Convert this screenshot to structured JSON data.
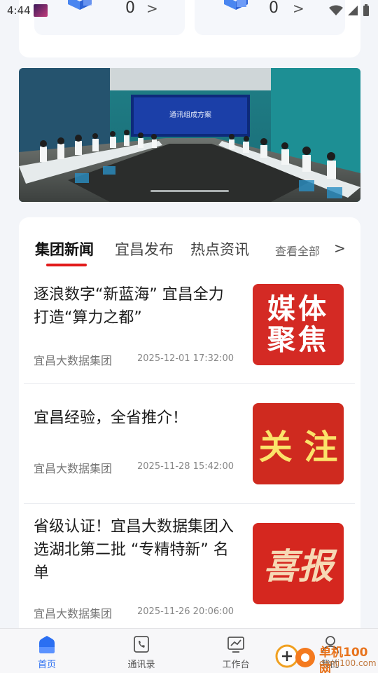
{
  "status_bar": {
    "time": "4:44"
  },
  "stats": [
    {
      "value": "0",
      "arrow": ">"
    },
    {
      "value": "0",
      "arrow": ">"
    }
  ],
  "banner": {
    "screen_text": "通讯组成方案",
    "icon": "meeting-room-photo"
  },
  "news_tabs": {
    "tabs": [
      "集团新闻",
      "宜昌发布",
      "热点资讯"
    ],
    "active_index": 0,
    "view_all": "查看全部",
    "view_all_arrow": ">"
  },
  "news": [
    {
      "title": "逐浪数字“新蓝海” 宜昌全力打造“算力之都”",
      "source": "宜昌大数据集团",
      "time": "2025-12-01 17:32:00",
      "thumb_text": "媒体聚焦"
    },
    {
      "title": "宜昌经验，全省推介！",
      "source": "宜昌大数据集团",
      "time": "2025-11-28 15:42:00",
      "thumb_text": "关 注"
    },
    {
      "title": "省级认证！宜昌大数据集团入选湖北第二批 “专精特新” 名单",
      "source": "宜昌大数据集团",
      "time": "2025-11-26 20:06:00",
      "thumb_text": "喜报"
    }
  ],
  "bottom_nav": [
    {
      "label": "首页",
      "icon": "home-icon",
      "active": true
    },
    {
      "label": "通讯录",
      "icon": "phone-book-icon",
      "active": false
    },
    {
      "label": "工作台",
      "icon": "workbench-chart-icon",
      "active": false
    },
    {
      "label": "我的",
      "icon": "user-icon",
      "active": false
    }
  ],
  "watermark": {
    "text": "单机100网",
    "url_text": "danji100.com"
  },
  "colors": {
    "accent": "#2b6ff2",
    "tab_underline": "#e21b1b",
    "thumb_red": "#d42a24"
  }
}
